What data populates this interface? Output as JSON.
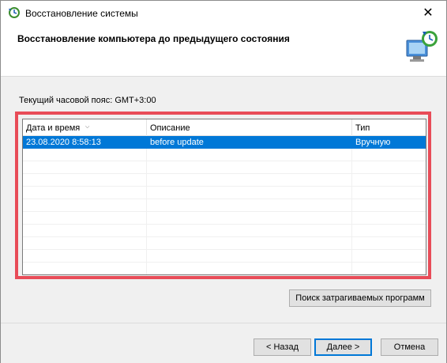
{
  "window": {
    "title": "Восстановление системы",
    "close_label": "✕"
  },
  "header": {
    "title": "Восстановление компьютера до предыдущего состояния"
  },
  "main": {
    "timezone_label": "Текущий часовой пояс: GMT+3:00",
    "columns": [
      "Дата и время",
      "Описание",
      "Тип"
    ],
    "rows": [
      {
        "datetime": "23.08.2020 8:58:13",
        "description": "before update",
        "type": "Вручную"
      }
    ],
    "scan_button": "Поиск затрагиваемых программ"
  },
  "footer": {
    "back_label": "< Назад",
    "next_label": "Далее >",
    "cancel_label": "Отмена"
  },
  "colors": {
    "selection": "#0078d7",
    "highlight_frame": "#e84c58"
  }
}
